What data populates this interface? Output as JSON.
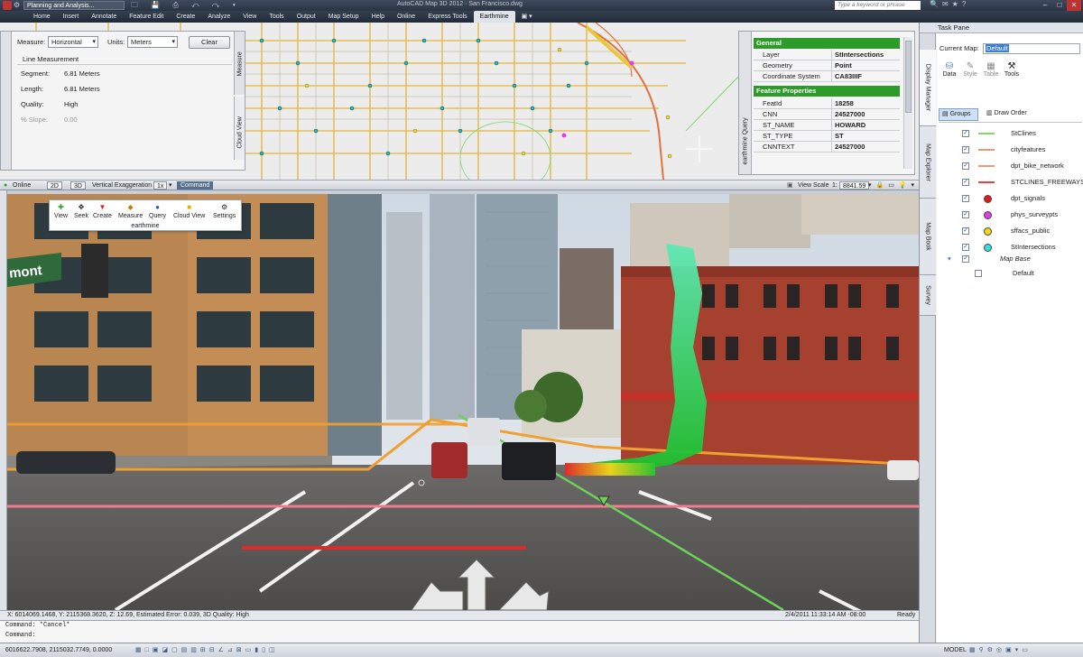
{
  "titlebar": {
    "workspace": "Planning and Analysis...",
    "app_title": "AutoCAD Map 3D 2012 · San Francisco.dwg",
    "search_placeholder": "Type a keyword or phrase"
  },
  "ribbon": {
    "tabs": [
      "Home",
      "Insert",
      "Annotate",
      "Feature Edit",
      "Create",
      "Analyze",
      "View",
      "Tools",
      "Output",
      "Map Setup",
      "Help",
      "Online",
      "Express Tools",
      "Earthmine",
      "▣ ▾"
    ],
    "active_index": 13
  },
  "measure": {
    "strip_label": "earthmine",
    "tab_label": "Measure",
    "cloudview_tab": "Cloud View",
    "measure_label": "Measure:",
    "measure_value": "Horizontal",
    "units_label": "Units:",
    "units_value": "Meters",
    "clear_label": "Clear",
    "section": "Line Measurement",
    "rows": [
      {
        "k": "Segment:",
        "v": "6.81 Meters"
      },
      {
        "k": "Length:",
        "v": "6.81 Meters"
      },
      {
        "k": "Quality:",
        "v": "High"
      },
      {
        "k": "% Slope:",
        "v": "0.00"
      }
    ]
  },
  "query": {
    "strip_label": "earthmine Query",
    "general_header": "General",
    "general_rows": [
      {
        "k": "Layer",
        "v": "StIntersections"
      },
      {
        "k": "Geometry",
        "v": "Point"
      },
      {
        "k": "Coordinate System",
        "v": "CA83IIIF"
      }
    ],
    "props_header": "Feature Properties",
    "props_rows": [
      {
        "k": "FeatId",
        "v": "18258"
      },
      {
        "k": "CNN",
        "v": "24527000"
      },
      {
        "k": "ST_NAME",
        "v": "HOWARD"
      },
      {
        "k": "ST_TYPE",
        "v": "ST"
      },
      {
        "k": "CNNTEXT",
        "v": "24527000"
      }
    ]
  },
  "midbar": {
    "online": "Online",
    "btn2d": "2D",
    "btn3d": "3D",
    "vex_label": "Vertical Exaggeration",
    "vex_value": "1x",
    "command": "Command",
    "view_scale_label": "View Scale",
    "scale_prefix": "1:",
    "scale_value": "8841.59"
  },
  "earthmine_toolbar": {
    "tools": [
      "View",
      "Seek",
      "Create",
      "Measure",
      "Query",
      "Cloud View",
      "Settings"
    ],
    "caption": "earthmine"
  },
  "street": {
    "sign_text": "mont",
    "cursor_glyph": "+"
  },
  "coordbar": {
    "coords": "X: 6014069.1468, Y: 2115368.3620, Z: 12.69, Estimated Error: 0.039, 3D Quality: High",
    "datetime": "2/4/2011 11:33:14 AM -08:00",
    "ready": "Ready"
  },
  "command": {
    "line1": "Command: *Cancel*",
    "line2": "Command:"
  },
  "statusbar": {
    "coords": "6016622.7908, 2115032.7749, 0.0000",
    "model": "MODEL"
  },
  "taskpane": {
    "title": "Task Pane",
    "current_map_label": "Current Map:",
    "current_map_value": "Default",
    "toolbar": [
      "Data",
      "Style",
      "Table",
      "Tools"
    ],
    "groups_btn": "Groups",
    "draw_order_btn": "Draw Order",
    "vtabs": [
      "Display Manager",
      "Map Explorer",
      "Map Book",
      "Survey"
    ],
    "layers": [
      {
        "name": "StClines",
        "kind": "line",
        "color": "#7fd86a",
        "checked": true
      },
      {
        "name": "cityfeatures",
        "kind": "line",
        "color": "#e59a7a",
        "checked": true
      },
      {
        "name": "dpt_bike_network",
        "kind": "line",
        "color": "#e59a7a",
        "checked": true
      },
      {
        "name": "STCLINES_FREEWAYS",
        "kind": "line",
        "color": "#e24444",
        "checked": true
      },
      {
        "name": "dpt_signals",
        "kind": "dot",
        "color": "#e01b1b",
        "checked": true
      },
      {
        "name": "phys_surveypts",
        "kind": "dot",
        "color": "#e13fe0",
        "checked": true
      },
      {
        "name": "sffacs_public",
        "kind": "dot",
        "color": "#ecdc14",
        "checked": true
      },
      {
        "name": "StIntersections",
        "kind": "dot",
        "color": "#33e0e0",
        "checked": true
      }
    ],
    "map_base": "Map Base",
    "default_item": "Default"
  },
  "colors": {
    "accent_green": "#2c9b2a",
    "ribbon_dark": "#222b37",
    "selection_blue": "#3a7fd0"
  }
}
